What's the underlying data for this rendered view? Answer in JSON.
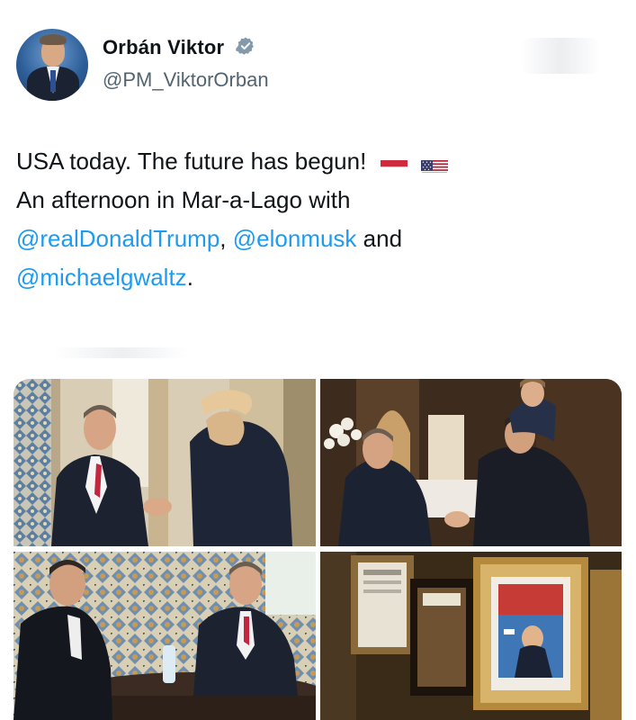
{
  "author": {
    "display_name": "Orbán Viktor",
    "handle": "@PM_ViktorOrban",
    "verified_icon": "verified-badge-icon"
  },
  "tweet": {
    "line1_text": "USA today. The future has begun!",
    "line2_text": "An afternoon in Mar-a-Lago with",
    "mention1": "@realDonaldTrump",
    "separator": ",",
    "mention2": "@elonmusk",
    "conjunction": "and",
    "mention3": "@michaelgwaltz",
    "period": ".",
    "flags": [
      "hungary-flag-icon",
      "usa-flag-icon"
    ]
  },
  "media": {
    "photos": [
      "handshake-photo",
      "greeting-photo",
      "meeting-table-photo",
      "framed-pictures-photo"
    ]
  },
  "colors": {
    "link": "#1d9bf0",
    "text": "#0f1419",
    "secondary": "#536471",
    "verified": "#829aab"
  }
}
